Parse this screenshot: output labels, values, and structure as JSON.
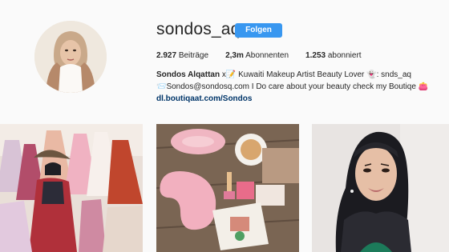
{
  "profile": {
    "username": "sondos_aq",
    "follow_label": "Folgen",
    "stats": [
      {
        "count": "2.927",
        "label": "Beiträge"
      },
      {
        "count": "2,3m",
        "label": "Abonnenten"
      },
      {
        "count": "1.253",
        "label": "abonniert"
      }
    ],
    "full_name": "Sondos Alqattan",
    "bio_line1": "x📝 Kuwaiti Makeup Artist Beauty Lover 👻: snds_aq",
    "bio_line2": "📨Sondos@sondosq.com I Do care about your beauty check my Boutiqe 👛",
    "website": "dl.boutiqaat.com/Sondos"
  },
  "posts": [
    {
      "icon": "photo-dresses"
    },
    {
      "icon": "photo-products"
    },
    {
      "icon": "photo-portrait"
    }
  ],
  "colors": {
    "follow_button": "#3897f0",
    "link": "#003569",
    "background": "#fafafa"
  }
}
